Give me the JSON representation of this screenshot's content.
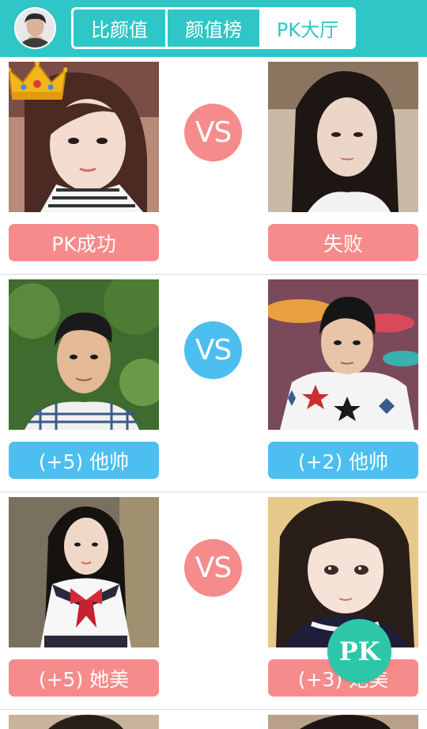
{
  "header": {
    "tabs": [
      {
        "label": "比颜值"
      },
      {
        "label": "颜值榜"
      },
      {
        "label": "PK大厅"
      }
    ],
    "active_tab": "PK大厅",
    "avatar": "user-avatar"
  },
  "matches": [
    {
      "vs": "VS",
      "theme": "pink",
      "left_label": "PK成功",
      "right_label": "失败",
      "winner_crown": "left"
    },
    {
      "vs": "VS",
      "theme": "blue",
      "left_label": "(+5)  他帅",
      "right_label": "(+2)  他帅"
    },
    {
      "vs": "VS",
      "theme": "pink",
      "left_label": "(+5)  她美",
      "right_label": "(+3)  她美"
    }
  ],
  "fab": {
    "label": "PK"
  },
  "colors": {
    "header_bg": "#2ec6c6",
    "pink": "#f68b8b",
    "blue": "#4dbef0",
    "fab": "#2ec6a8"
  }
}
